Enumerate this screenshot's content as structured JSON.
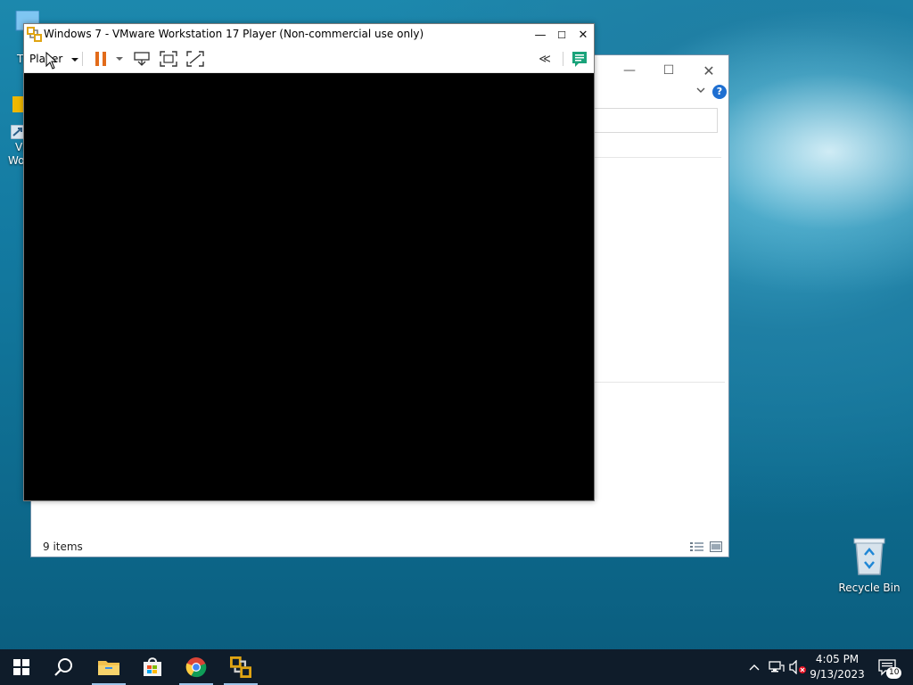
{
  "desktop": {
    "fragment_top": "T",
    "fragment_vm": "VI",
    "fragment_wo": "Wo",
    "recycle_bin_label": "Recycle Bin"
  },
  "explorer": {
    "status_text": "9 items",
    "help_glyph": "?"
  },
  "vmware": {
    "title": "Windows 7 - VMware Workstation 17 Player (Non-commercial use only)",
    "player_menu_label": "Player",
    "collapse_label": "≪"
  },
  "taskbar": {
    "time": "4:05 PM",
    "date": "9/13/2023",
    "notification_count": "10"
  },
  "colors": {
    "accent_orange": "#e26b1a",
    "vm_screen": "#000000",
    "taskbar": "#0f1c2a",
    "notes_green": "#1aa37a"
  }
}
